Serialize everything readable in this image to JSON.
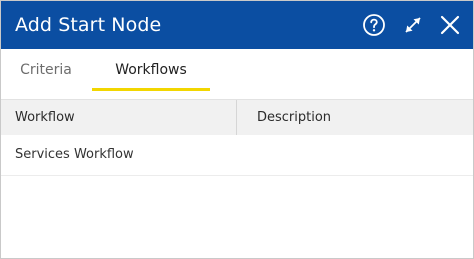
{
  "dialog": {
    "title": "Add Start Node",
    "icons": {
      "help": "help-circle-icon",
      "expand": "expand-icon",
      "close": "close-icon"
    }
  },
  "tabs": [
    {
      "label": "Criteria",
      "active": false
    },
    {
      "label": "Workflows",
      "active": true
    }
  ],
  "grid": {
    "columns": [
      "Workflow",
      "Description"
    ],
    "rows": [
      {
        "workflow": "Services Workflow",
        "description": ""
      }
    ]
  },
  "colors": {
    "titlebar": "#0b4ea2",
    "tab_accent": "#f2d600",
    "header_bg": "#f1f1f1"
  }
}
